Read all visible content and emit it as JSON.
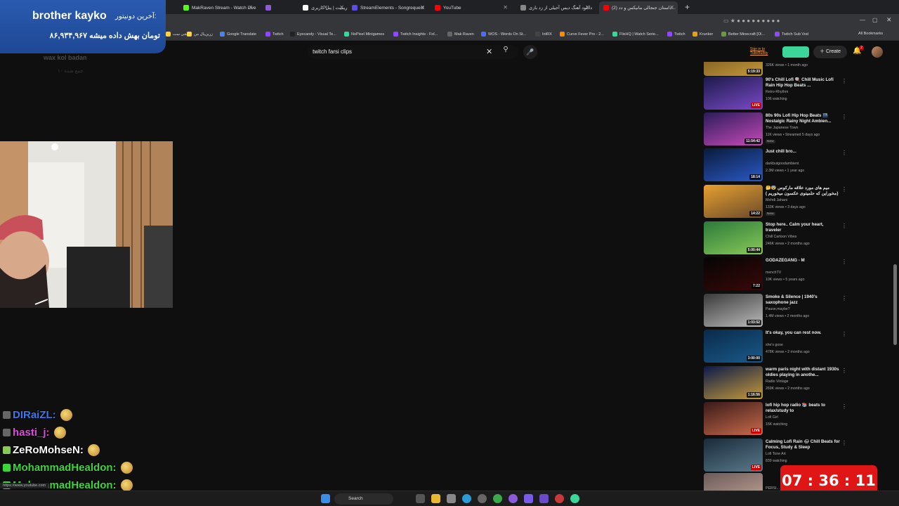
{
  "browser": {
    "tabs": [
      {
        "label": "MakRaven Stream - Watch Live",
        "color": "#53fc18",
        "active": false
      },
      {
        "label": "",
        "color": "#8e5bd6",
        "active": false
      },
      {
        "label": "ریمیت | پنل کاربری",
        "color": "#ffffff",
        "active": false
      },
      {
        "label": "StreamElements - Songrequest",
        "color": "#5b4de6",
        "active": false
      },
      {
        "label": "YouTube",
        "color": "#ff0000",
        "active": false
      },
      {
        "label": "دانلود آهنگ دیس آجیلی از زد بازی",
        "color": "#888888",
        "active": false
      },
      {
        "label": "(2) داستان جنجالی مانیکس و دد...",
        "color": "#ff0000",
        "active": true
      }
    ],
    "bookmarks": [
      {
        "label": "دیجی ست",
        "color": "#ffd24a"
      },
      {
        "label": "زرین‌پال من",
        "color": "#ffd24a"
      },
      {
        "label": "Google Translate",
        "color": "#4285f4"
      },
      {
        "label": "Twitch",
        "color": "#9146ff"
      },
      {
        "label": "Eyecandy - Visual Te...",
        "color": "#222222"
      },
      {
        "label": "NoPixel Minigames",
        "color": "#3ad69a"
      },
      {
        "label": "Twitch Insights - Fol...",
        "color": "#9146ff"
      },
      {
        "label": "Mak Raven",
        "color": "#666666"
      },
      {
        "label": "WOS - Words On St...",
        "color": "#4a6cff"
      },
      {
        "label": "IntRX",
        "color": "#444444"
      },
      {
        "label": "Curve Fever Pro - 2...",
        "color": "#ff8a00"
      },
      {
        "label": "FlixHQ | Watch Serie...",
        "color": "#3ad69a"
      },
      {
        "label": "Twitch",
        "color": "#9146ff"
      },
      {
        "label": "Krunker",
        "color": "#e0a020"
      },
      {
        "label": "Better Minecraft [Ol...",
        "color": "#6a9a3a"
      },
      {
        "label": "Twitch Sub Vod",
        "color": "#9146ff"
      }
    ],
    "all_bookmarks": "All Bookmarks",
    "status_url": "https://www.youtube.com"
  },
  "youtube": {
    "search_value": "twitch farsi clips",
    "signin_link": "Sign in to TubeBuddy",
    "create_label": "Create",
    "notification_count": "2"
  },
  "recommendations": [
    {
      "title": "",
      "channel": "",
      "meta": "326K views • 1 month ago",
      "duration": "5:19:33",
      "live": false,
      "new": false,
      "thumb": [
        "#6b4a1a",
        "#c49a3a"
      ]
    },
    {
      "title": "90's Chill Lofi 🍭 Chill Music Lofi Rain Hip Hop Beats ...",
      "channel": "Retro-Rhythm",
      "meta": "106 watching",
      "duration": "LIVE",
      "live": true,
      "new": false,
      "thumb": [
        "#1c1a4a",
        "#7a4ac8"
      ]
    },
    {
      "title": "80s 90s Lofi Hip Hop Beats 🌃 Nostalgic Rainy Night Ambien...",
      "channel": "The Japanese Town",
      "meta": "11K views • Streamed 5 days ago",
      "duration": "11:54:42",
      "live": false,
      "new": true,
      "thumb": [
        "#2a1c5a",
        "#c84ab8"
      ]
    },
    {
      "title": "Just chill bro...",
      "channel": "darkbutgoodambient",
      "meta": "2.3M views • 1 year ago",
      "duration": "18:14",
      "live": false,
      "new": false,
      "thumb": [
        "#0a1a3a",
        "#2a5ac8"
      ]
    },
    {
      "title": "🤔😨 میم های مورد علاقه مارکوس (مخوراین که حلمیتوی عکسون میخوریم ) تمرین",
      "channel": "Mehdi Jahani",
      "meta": "133K views • 3 days ago",
      "duration": "14:22",
      "live": false,
      "new": true,
      "thumb": [
        "#e8a030",
        "#6a4a2a"
      ]
    },
    {
      "title": "Stop here.. Calm your heart, traveler",
      "channel": "Chill Cartoon Vibes",
      "meta": "246K views • 2 months ago",
      "duration": "5:00:44",
      "live": false,
      "new": false,
      "thumb": [
        "#2a7a3a",
        "#8ac858"
      ]
    },
    {
      "title": "GODAZEGANG - M",
      "channel": "menchTV",
      "meta": "10K views • 5 years ago",
      "duration": "7:22",
      "live": false,
      "new": false,
      "thumb": [
        "#050505",
        "#3a0808"
      ]
    },
    {
      "title": "Smoke & Silence | 1940's saxophone jazz",
      "channel": "Pause,maybe?",
      "meta": "1.4M views • 2 months ago",
      "duration": "1:03:52",
      "live": false,
      "new": false,
      "thumb": [
        "#3a3a3a",
        "#bbbbbb"
      ]
    },
    {
      "title": "It's okay, you can rest now.",
      "channel": "she's gone",
      "meta": "478K views • 2 months ago",
      "duration": "3:00:00",
      "live": false,
      "new": false,
      "thumb": [
        "#0a2a4a",
        "#1a5a8a"
      ]
    },
    {
      "title": "warm paris night with distant 1930s oldies playing in anothe...",
      "channel": "Radio Vintage",
      "meta": "269K views • 2 months ago",
      "duration": "1:16:56",
      "live": false,
      "new": false,
      "thumb": [
        "#0a1a4a",
        "#c89a3a"
      ]
    },
    {
      "title": "lofi hip hop radio 📚 beats to relax/study to",
      "channel": "Lofi Girl",
      "meta": "15K watching",
      "duration": "LIVE",
      "live": true,
      "new": false,
      "thumb": [
        "#3a1a1a",
        "#c86a4a"
      ]
    },
    {
      "title": "Calming Lofi Rain 🌧 Chill Beats for Focus, Study & Sleep",
      "channel": "Lofi Tone Art",
      "meta": "839 watching",
      "duration": "LIVE",
      "live": true,
      "new": false,
      "thumb": [
        "#1a2a3a",
        "#5a7a8a"
      ]
    },
    {
      "title": "",
      "channel": "PERSI...",
      "meta": "",
      "duration": "",
      "live": false,
      "new": false,
      "thumb": [
        "#6a5a5a",
        "#c8a898"
      ]
    }
  ],
  "overlay": {
    "donor_label": "آخرین دونیتور:",
    "donor_name": "brother kayko",
    "donor_amount": "۸۶,۹۳۴,۹۶۷ تومان بهش داده میشه",
    "goal_text": "wax kol badan",
    "goal_sub": "۱۰ جمع شده",
    "timer": "07 : 36 : 11",
    "chat": [
      {
        "user": "DIRaiZL",
        "color": "#3a7ae8",
        "badge": "#666666"
      },
      {
        "user": "hasti_j",
        "color": "#e04ae0",
        "badge": "#666666"
      },
      {
        "user": "ZeRoMohseN",
        "color": "#ffffff",
        "badge": "#8ac858"
      },
      {
        "user": "MohammadHealdon",
        "color": "#3ad63a",
        "badge": "#3ad63a"
      },
      {
        "user": "MohammadHealdon",
        "color": "#3ad63a",
        "badge": "#3ad63a"
      }
    ]
  },
  "taskbar": {
    "search_label": "Search"
  }
}
